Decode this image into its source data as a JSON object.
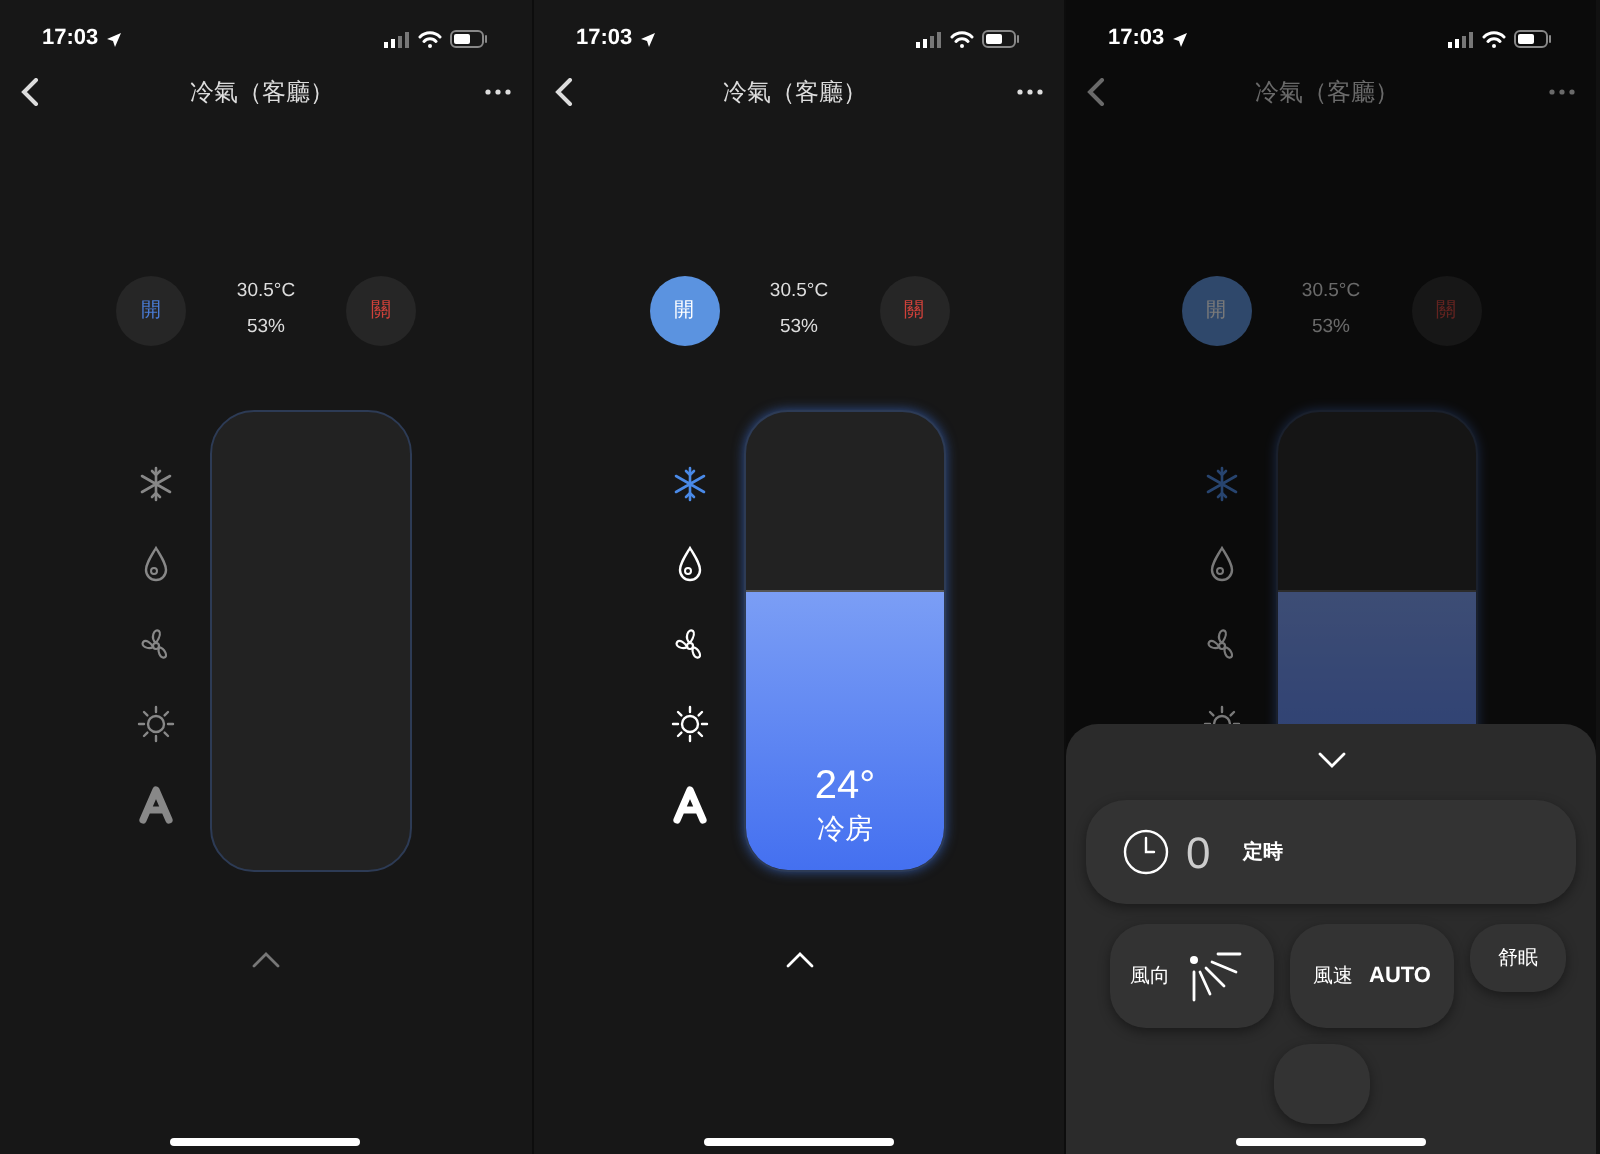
{
  "screens": [
    {
      "status_bar": {
        "time": "17:03"
      },
      "title": "冷氣（客廳）",
      "dimmed": false,
      "power": {
        "on": false,
        "on_label": "開",
        "off_label": "關"
      },
      "reading": {
        "temperature": "30.5°C",
        "humidity": "53%"
      },
      "modes": [
        {
          "kind": "cool",
          "selected": false
        },
        {
          "kind": "dry",
          "selected": false
        },
        {
          "kind": "fan",
          "selected": false
        },
        {
          "kind": "heat",
          "selected": false
        },
        {
          "kind": "auto",
          "selected": false
        }
      ],
      "slider": {
        "level": 0
      },
      "expand": true
    },
    {
      "status_bar": {
        "time": "17:03"
      },
      "title": "冷氣（客廳）",
      "dimmed": false,
      "power": {
        "on": true,
        "on_label": "開",
        "off_label": "關"
      },
      "reading": {
        "temperature": "30.5°C",
        "humidity": "53%"
      },
      "modes": [
        {
          "kind": "cool",
          "selected": true
        },
        {
          "kind": "dry",
          "selected": false
        },
        {
          "kind": "fan",
          "selected": false
        },
        {
          "kind": "heat",
          "selected": false
        },
        {
          "kind": "auto",
          "selected": false
        }
      ],
      "slider": {
        "level": 0.61,
        "temperature": "24°",
        "mode_label": "冷房"
      },
      "expand": true
    },
    {
      "status_bar": {
        "time": "17:03"
      },
      "title": "冷氣（客廳）",
      "dimmed": true,
      "power": {
        "on": true,
        "on_label": "開",
        "off_label": "關"
      },
      "reading": {
        "temperature": "30.5°C",
        "humidity": "53%"
      },
      "modes": [
        {
          "kind": "cool",
          "selected": true
        },
        {
          "kind": "dry",
          "selected": false
        },
        {
          "kind": "fan",
          "selected": false
        },
        {
          "kind": "heat",
          "selected": false
        }
      ],
      "slider": {
        "level": 0.61
      },
      "expand": false,
      "sheet": {
        "timer": {
          "value": "0",
          "label": "定時"
        },
        "buttons": [
          {
            "kind": "direction",
            "label": "風向"
          },
          {
            "kind": "speed",
            "label": "風速",
            "value": "AUTO"
          },
          {
            "kind": "small",
            "label": "舒眠"
          },
          {
            "kind": "partial"
          }
        ]
      }
    }
  ]
}
